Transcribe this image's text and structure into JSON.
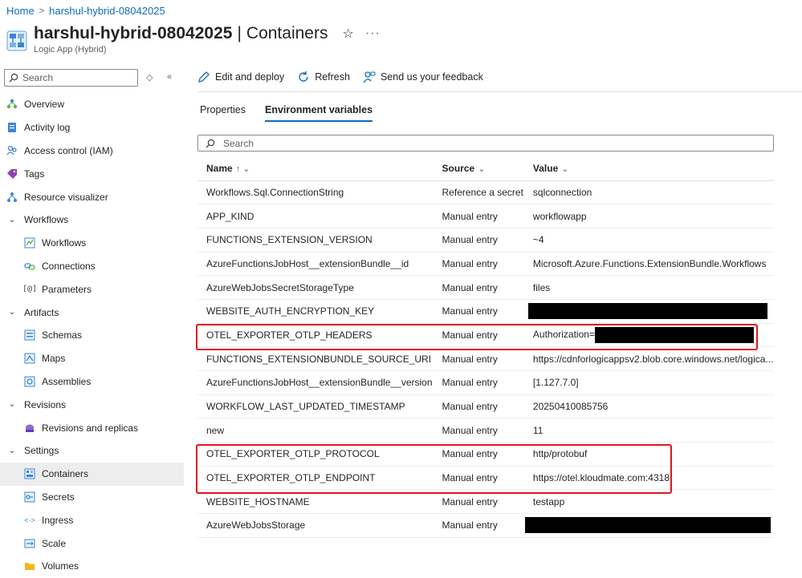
{
  "breadcrumb": {
    "home": "Home",
    "resource": "harshul-hybrid-08042025"
  },
  "header": {
    "resource_name": "harshul-hybrid-08042025",
    "separator": "|",
    "page": "Containers",
    "subtitle": "Logic App (Hybrid)"
  },
  "sidebar": {
    "search_placeholder": "Search",
    "items": [
      {
        "label": "Overview"
      },
      {
        "label": "Activity log"
      },
      {
        "label": "Access control (IAM)"
      },
      {
        "label": "Tags"
      },
      {
        "label": "Resource visualizer"
      },
      {
        "label": "Workflows"
      },
      {
        "label": "Workflows"
      },
      {
        "label": "Connections"
      },
      {
        "label": "Parameters"
      },
      {
        "label": "Artifacts"
      },
      {
        "label": "Schemas"
      },
      {
        "label": "Maps"
      },
      {
        "label": "Assemblies"
      },
      {
        "label": "Revisions"
      },
      {
        "label": "Revisions and replicas"
      },
      {
        "label": "Settings"
      },
      {
        "label": "Containers"
      },
      {
        "label": "Secrets"
      },
      {
        "label": "Ingress"
      },
      {
        "label": "Scale"
      },
      {
        "label": "Volumes"
      }
    ]
  },
  "toolbar": {
    "edit": "Edit and deploy",
    "refresh": "Refresh",
    "feedback": "Send us your feedback"
  },
  "tabs": [
    "Properties",
    "Environment variables"
  ],
  "search": {
    "placeholder": "Search"
  },
  "table": {
    "headers": {
      "name": "Name",
      "source": "Source",
      "value": "Value"
    },
    "rows": [
      {
        "name": "Workflows.Sql.ConnectionString",
        "source": "Reference a secret",
        "value": "sqlconnection"
      },
      {
        "name": "APP_KIND",
        "source": "Manual entry",
        "value": "workflowapp"
      },
      {
        "name": "FUNCTIONS_EXTENSION_VERSION",
        "source": "Manual entry",
        "value": "~4"
      },
      {
        "name": "AzureFunctionsJobHost__extensionBundle__id",
        "source": "Manual entry",
        "value": "Microsoft.Azure.Functions.ExtensionBundle.Workflows"
      },
      {
        "name": "AzureWebJobsSecretStorageType",
        "source": "Manual entry",
        "value": "files"
      },
      {
        "name": "WEBSITE_AUTH_ENCRYPTION_KEY",
        "source": "Manual entry",
        "value": ""
      },
      {
        "name": "OTEL_EXPORTER_OTLP_HEADERS",
        "source": "Manual entry",
        "value": "Authorization="
      },
      {
        "name": "FUNCTIONS_EXTENSIONBUNDLE_SOURCE_URI",
        "source": "Manual entry",
        "value": "https://cdnforlogicappsv2.blob.core.windows.net/logica..."
      },
      {
        "name": "AzureFunctionsJobHost__extensionBundle__version",
        "source": "Manual entry",
        "value": "[1.127.7.0]"
      },
      {
        "name": "WORKFLOW_LAST_UPDATED_TIMESTAMP",
        "source": "Manual entry",
        "value": "20250410085756"
      },
      {
        "name": "new",
        "source": "Manual entry",
        "value": "11"
      },
      {
        "name": "OTEL_EXPORTER_OTLP_PROTOCOL",
        "source": "Manual entry",
        "value": "http/protobuf"
      },
      {
        "name": "OTEL_EXPORTER_OTLP_ENDPOINT",
        "source": "Manual entry",
        "value": "https://otel.kloudmate.com:4318"
      },
      {
        "name": "WEBSITE_HOSTNAME",
        "source": "Manual entry",
        "value": "testapp"
      },
      {
        "name": "AzureWebJobsStorage",
        "source": "Manual entry",
        "value": ""
      }
    ]
  },
  "colors": {
    "accent": "#0f6cbd",
    "highlight": "#e0151d",
    "active_bg": "#ededed"
  }
}
